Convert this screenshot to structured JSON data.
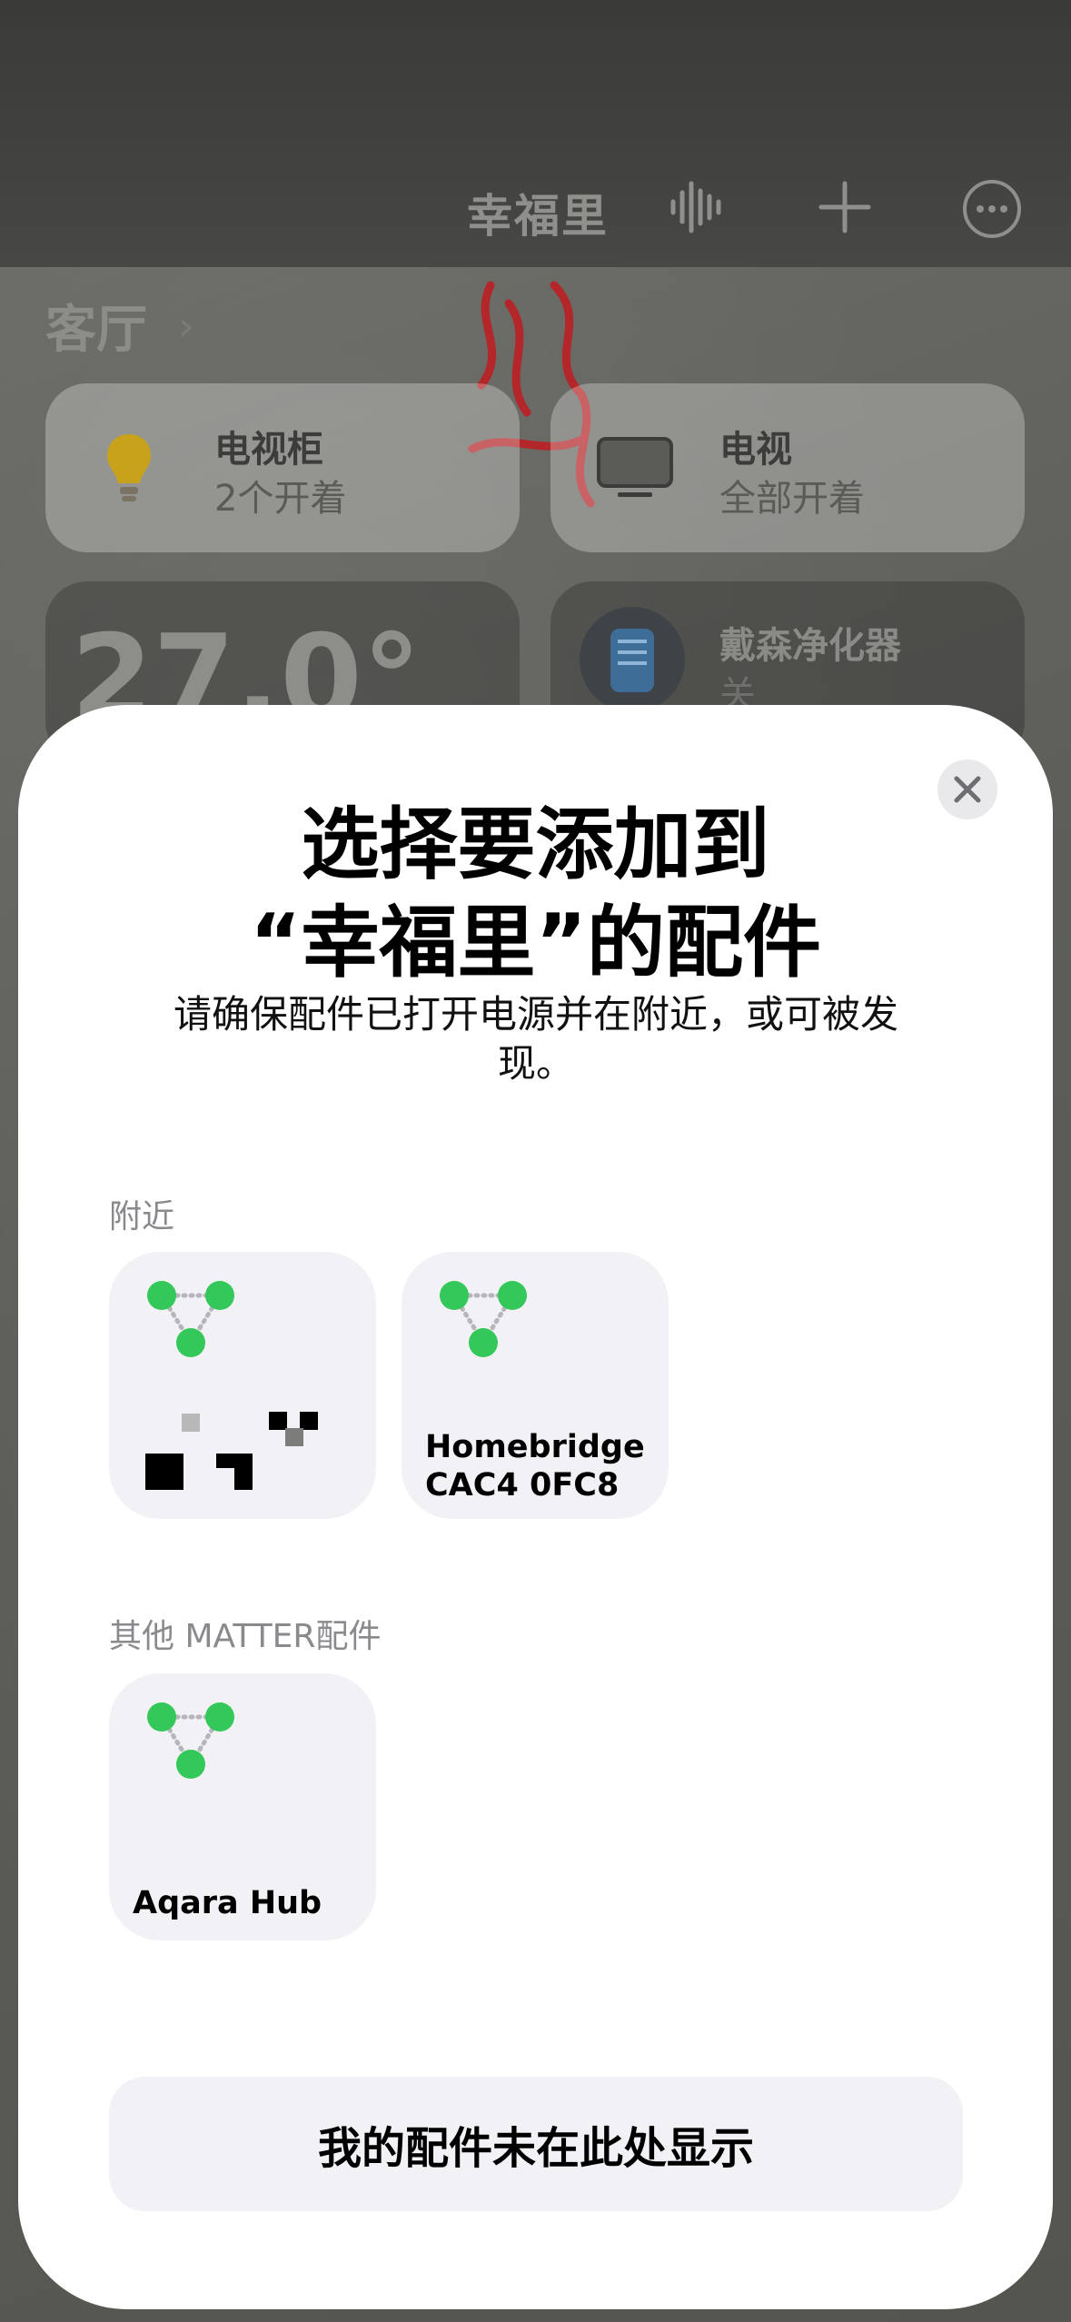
{
  "header": {
    "home_name": "幸福里",
    "icons": [
      "waveform-icon",
      "plus-icon",
      "more-icon"
    ]
  },
  "room": {
    "name": "客厅",
    "tiles": [
      {
        "name": "电视柜",
        "status": "2个开着",
        "icon": "lightbulb-icon"
      },
      {
        "name": "电视",
        "status": "全部开着",
        "icon": "tv-icon"
      },
      {
        "name": "戴森净化器",
        "status": "关",
        "icon": "air-purifier-icon"
      }
    ],
    "temperature": "27.0°"
  },
  "sheet": {
    "title": "选择要添加到\n“幸福里”的配件",
    "subtitle": "请确保配件已打开电源并在附近，或可被发现。",
    "nearby_label": "附近",
    "nearby": [
      {
        "name": "",
        "icon": "matter-icon"
      },
      {
        "name": "Homebridge\nCAC4 0FC8",
        "icon": "matter-icon"
      }
    ],
    "other_label": "其他 MATTER配件",
    "other": [
      {
        "name": "Aqara Hub",
        "icon": "matter-icon"
      }
    ],
    "bottom_button": "我的配件未在此处显示"
  },
  "colors": {
    "matter_green": "#34c759",
    "card_bg": "#f2f2f6",
    "secondary_text": "#8a8a8e"
  }
}
